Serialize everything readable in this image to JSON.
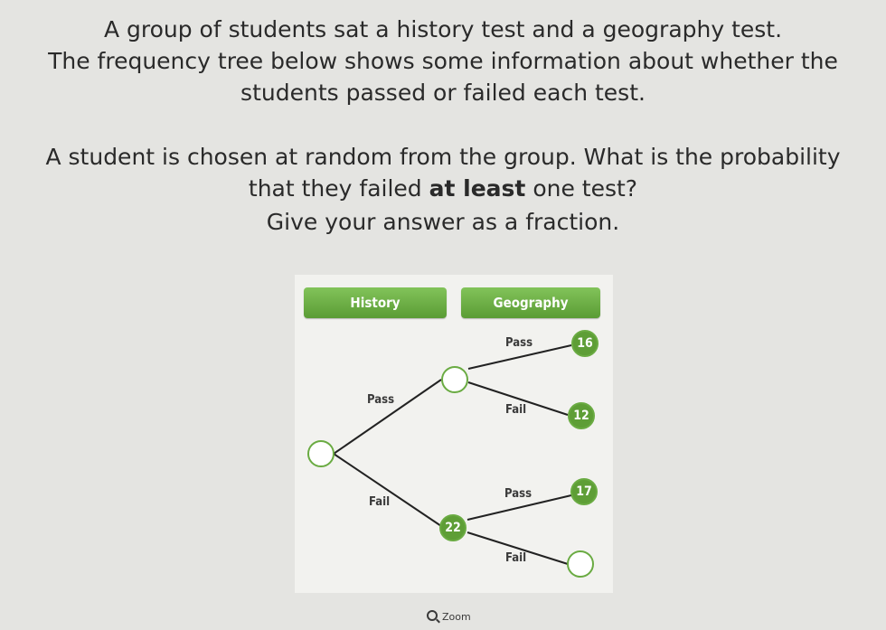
{
  "question": {
    "line1": "A group of students sat a history test and a geography test.",
    "line2": "The frequency tree below shows some information about whether the",
    "line3": "students passed or failed each test.",
    "line4": "A student is chosen at random from the group. What is the probability",
    "line5_pre": "that they failed ",
    "line5_bold": "at least",
    "line5_post": " one test?",
    "line6": "Give your answer as a fraction."
  },
  "tree": {
    "history_label": "History",
    "geography_label": "Geography",
    "history_pass": "Pass",
    "history_fail": "Fail",
    "history_fail_value": "22",
    "pass_pass": "Pass",
    "pass_pass_value": "16",
    "pass_fail": "Fail",
    "pass_fail_value": "12",
    "fail_pass": "Pass",
    "fail_pass_value": "17",
    "fail_fail": "Fail",
    "accent_color": "#5e9e36"
  },
  "zoom": {
    "label": "Zoom",
    "icon": "magnifier-icon"
  }
}
